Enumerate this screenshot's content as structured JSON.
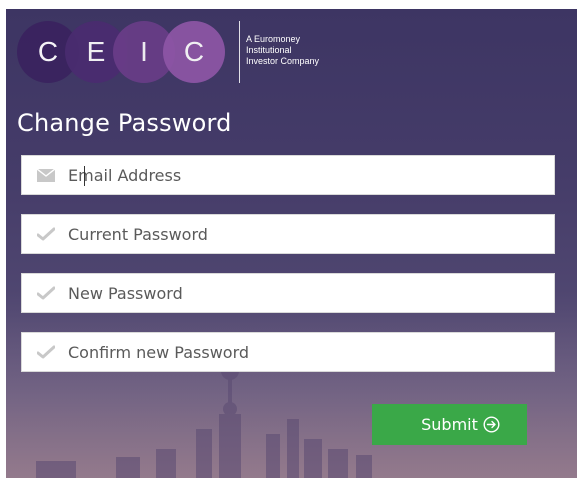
{
  "logo": {
    "letters": [
      "C",
      "E",
      "I",
      "C"
    ],
    "tagline": [
      "A Euromoney",
      "Institutional",
      "Investor Company"
    ]
  },
  "form": {
    "title": "Change Password",
    "fields": [
      {
        "placeholder": "Email Address",
        "icon": "envelope-icon"
      },
      {
        "placeholder": "Current Password",
        "icon": "checkmark-icon"
      },
      {
        "placeholder": "New Password",
        "icon": "checkmark-icon"
      },
      {
        "placeholder": "Confirm new Password",
        "icon": "checkmark-icon"
      }
    ],
    "submit_label": "Submit",
    "submit_icon": "arrow-circle-right-icon"
  },
  "colors": {
    "background": "#453c69",
    "submit": "#3aa848",
    "icon_gray": "#c8c8c8"
  }
}
